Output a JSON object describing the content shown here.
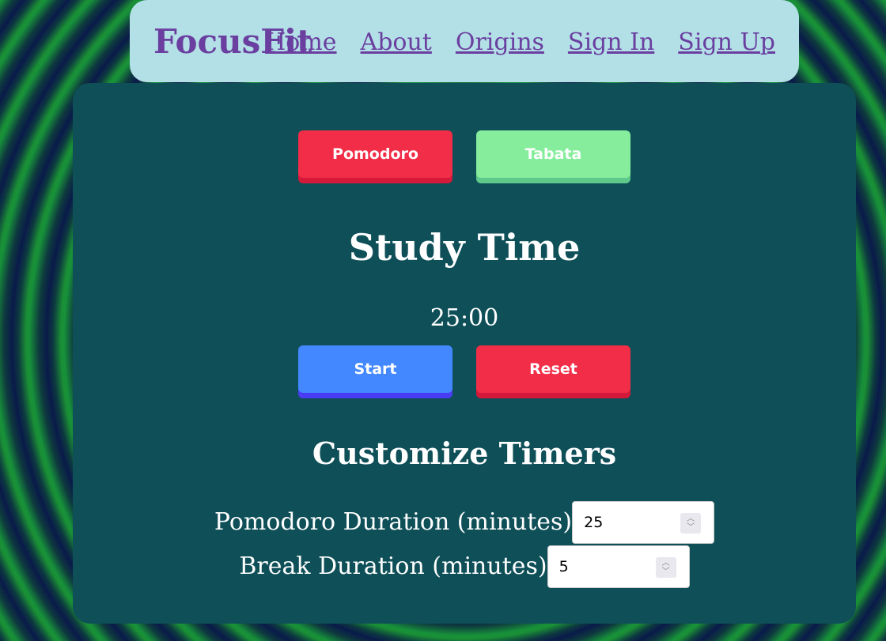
{
  "nav": {
    "brand": "FocusFit",
    "links": [
      "Home",
      "About",
      "Origins",
      "Sign In",
      "Sign Up"
    ]
  },
  "modes": {
    "pomodoro": "Pomodoro",
    "tabata": "Tabata"
  },
  "heading": "Study Time",
  "timer": "25:00",
  "controls": {
    "start": "Start",
    "reset": "Reset"
  },
  "customize": {
    "title": "Customize Timers",
    "pomodoro_label": "Pomodoro Duration (minutes)",
    "pomodoro_value": "25",
    "break_label": "Break Duration (minutes)",
    "break_value": "5"
  },
  "colors": {
    "brand": "#6a3fa0",
    "nav_bg": "#b3e0e6",
    "panel_bg": "#0e4f58",
    "red": "#f22d48",
    "green": "#86ed9c",
    "blue": "#4488ff"
  }
}
